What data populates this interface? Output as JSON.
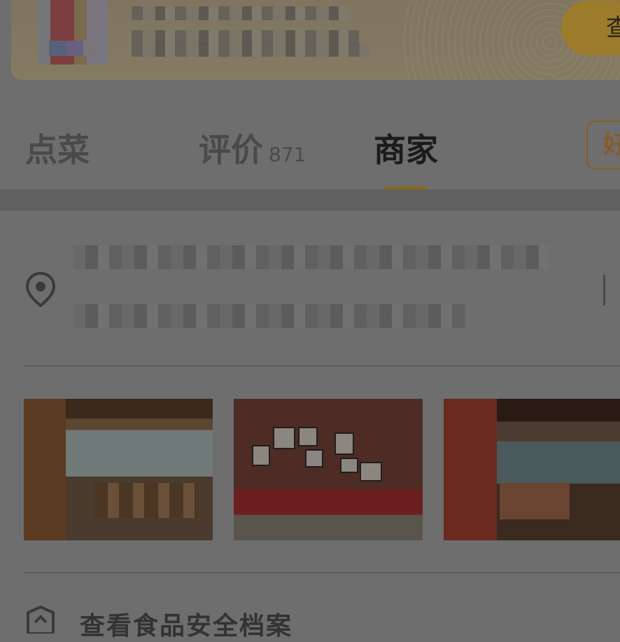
{
  "banner": {
    "action_label": "查"
  },
  "tabs": [
    {
      "label": "点菜",
      "count": ""
    },
    {
      "label": "评价",
      "count": "871"
    },
    {
      "label": "商家",
      "count": ""
    }
  ],
  "tab_extra_label": "好",
  "store": {
    "photos": [
      "restaurant-interior-photo",
      "brick-wall-seating-photo",
      "dining-hall-photo"
    ]
  },
  "safety": {
    "label": "查看食品安全档案"
  },
  "colors": {
    "accent_gold": "#8a6a18",
    "overlay_dim": "#6e6e6e"
  }
}
